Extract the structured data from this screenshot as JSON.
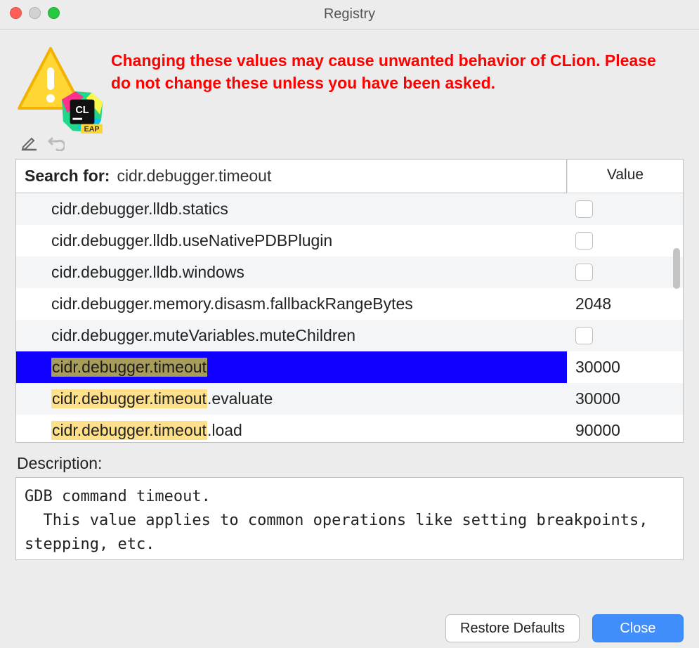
{
  "window": {
    "title": "Registry"
  },
  "warning": "Changing these values may cause unwanted behavior of CLion. Please do not change these unless you have been asked.",
  "badge": {
    "abbr": "CL",
    "ribbon": "EAP"
  },
  "search": {
    "label": "Search for:",
    "term": "cidr.debugger.timeout"
  },
  "columns": {
    "value": "Value"
  },
  "rows": [
    {
      "key": "cidr.debugger.lldb.statics",
      "type": "bool",
      "value": ""
    },
    {
      "key": "cidr.debugger.lldb.useNativePDBPlugin",
      "type": "bool",
      "value": ""
    },
    {
      "key": "cidr.debugger.lldb.windows",
      "type": "bool",
      "value": ""
    },
    {
      "key": "cidr.debugger.memory.disasm.fallbackRangeBytes",
      "type": "text",
      "value": "2048"
    },
    {
      "key": "cidr.debugger.muteVariables.muteChildren",
      "type": "bool",
      "value": ""
    },
    {
      "key": "cidr.debugger.timeout",
      "type": "text",
      "value": "30000",
      "selected": true
    },
    {
      "key": "cidr.debugger.timeout.evaluate",
      "type": "text",
      "value": "30000"
    },
    {
      "key": "cidr.debugger.timeout.load",
      "type": "text",
      "value": "90000"
    }
  ],
  "description": {
    "label": "Description:",
    "text": "GDB command timeout.\n  This value applies to common operations like setting breakpoints, stepping, etc."
  },
  "buttons": {
    "restore": "Restore Defaults",
    "close": "Close"
  }
}
